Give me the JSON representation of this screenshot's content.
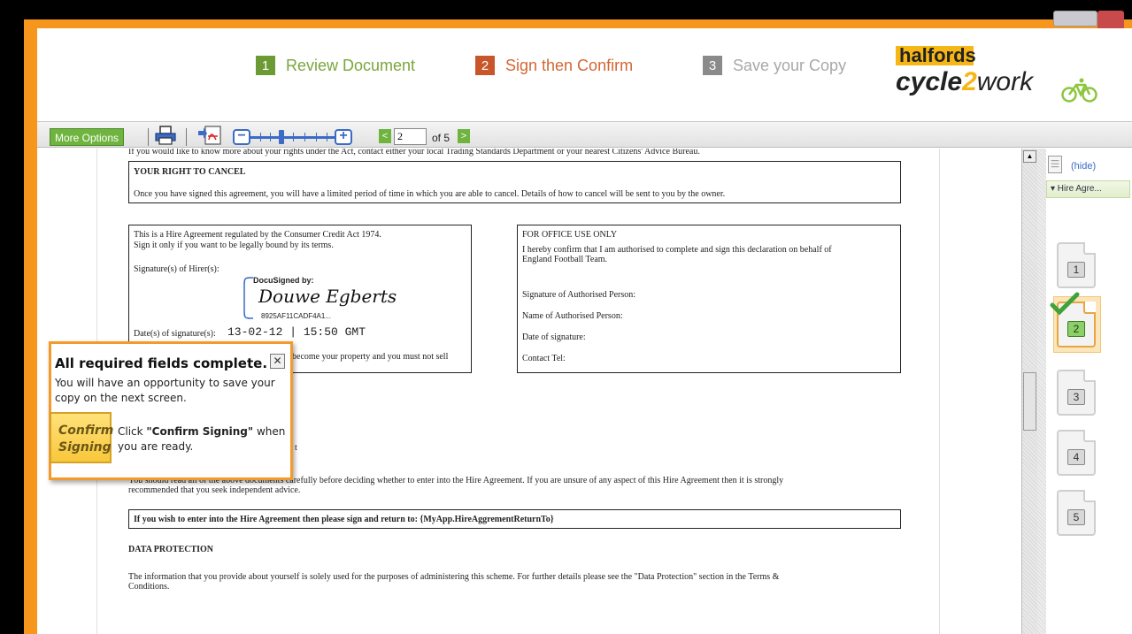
{
  "steps": [
    {
      "num": "1",
      "label": "Review Document"
    },
    {
      "num": "2",
      "label": "Sign then Confirm"
    },
    {
      "num": "3",
      "label": "Save your Copy"
    }
  ],
  "logo": {
    "top": "halfords",
    "cycle": "cycle",
    "two": "2",
    "work": "work"
  },
  "toolbar": {
    "more_options": "More Options",
    "prev": "<",
    "page_value": "2",
    "page_of": "of 5",
    "next": ">"
  },
  "document": {
    "rights_line": "If you would like to know more about your rights under the Act, contact either your local Trading Standards Department or your nearest Citizens' Advice Bureau.",
    "cancel_heading": "YOUR RIGHT TO CANCEL",
    "cancel_text": "Once you have signed this agreement, you will have a limited period of time in which you are able to cancel. Details of how to cancel will be sent to you by the owner.",
    "hire_line1": "This is a Hire Agreement regulated by the Consumer Credit Act 1974.",
    "hire_line2": "Sign it only if you want to be legally bound by its terms.",
    "signature_label": "Signature(s) of Hirer(s):",
    "docusign_label": "DocuSigned by:",
    "signature_name": "Douwe Egberts",
    "signature_id": "8925AF11CADF4A1...",
    "date_label": "Date(s) of signature(s):",
    "date_value": "13-02-12 | 15:50 GMT",
    "property_text": "become your property and you must not sell",
    "office_heading": "FOR OFFICE USE ONLY",
    "office_line1": "I hereby confirm that I am authorised to complete and sign this declaration on behalf of",
    "office_line2": "England Football Team.",
    "auth_signature": "Signature of Authorised Person:",
    "auth_name": "Name of Authorised Person:",
    "auth_date": "Date of signature:",
    "contact_tel": "Contact Tel:",
    "partial_t": "t",
    "read_line1": "You should read all of the above documents carefully before deciding whether to enter into the Hire Agreement. If you are unsure of any aspect of this Hire Agreement then it is strongly",
    "read_line2": "recommended that you seek independent advice.",
    "return_text": "If you wish to enter into the Hire Agreement then please sign and return to: {MyApp.HireAggrementReturnTo}",
    "data_heading": "DATA PROTECTION",
    "data_line1": "The information that you provide about yourself is solely used for the purposes of administering this scheme. For further details please see the \"Data Protection\" section in the Terms &",
    "data_line2": "Conditions."
  },
  "sidebar": {
    "hide": "(hide)",
    "tab": "▾ Hire Agre...",
    "pages": [
      "1",
      "2",
      "3",
      "4",
      "5"
    ]
  },
  "popup": {
    "title": "All required fields complete.",
    "close": "✕",
    "body": "You will have an opportunity to save your copy on the next screen.",
    "confirm_line1": "Confirm",
    "confirm_line2": "Signing",
    "instr_pre": "Click ",
    "instr_bold": "\"Confirm Signing\"",
    "instr_post": " when you are ready."
  },
  "colors": {
    "frame_orange": "#f7961d",
    "step1": "#6c9a34",
    "step2": "#c9552a",
    "step3": "#8a8a8a",
    "brand_yellow": "#f6b616"
  }
}
